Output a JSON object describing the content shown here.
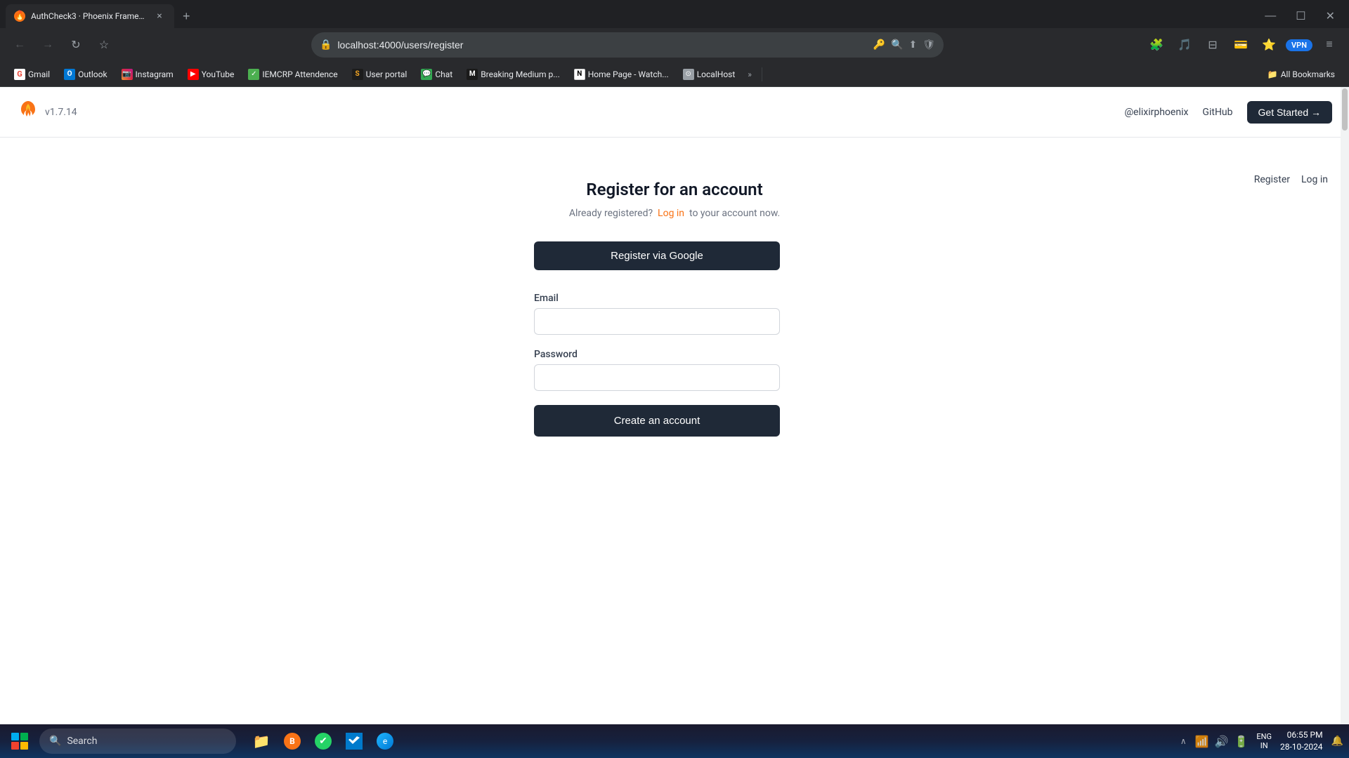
{
  "browser": {
    "tab": {
      "title": "AuthCheck3 · Phoenix Framew...",
      "favicon": "🔥",
      "close_label": "×"
    },
    "new_tab_label": "+",
    "window_controls": {
      "minimize": "—",
      "maximize": "☐",
      "close": "✕"
    },
    "nav": {
      "back": "←",
      "forward": "→",
      "reload": "↻",
      "bookmark": "☆",
      "address": "localhost:4000/users/register",
      "lock_icon": "🔒",
      "icons": [
        "🔑",
        "🔍",
        "⬆",
        "🛡"
      ],
      "vpn_label": "VPN",
      "menu": "≡"
    },
    "bookmarks": [
      {
        "label": "Gmail",
        "icon": "G",
        "color_class": "bk-gmail"
      },
      {
        "label": "Outlook",
        "icon": "O",
        "color_class": "bk-outlook"
      },
      {
        "label": "Instagram",
        "icon": "📷",
        "color_class": "bk-instagram"
      },
      {
        "label": "YouTube",
        "icon": "▶",
        "color_class": "bk-youtube"
      },
      {
        "label": "IEMCRP Attendence",
        "icon": "✓",
        "color_class": "bk-iemcrp"
      },
      {
        "label": "User portal",
        "icon": "S",
        "color_class": "bk-scrimba"
      },
      {
        "label": "Chat",
        "icon": "💬",
        "color_class": "bk-chat"
      },
      {
        "label": "Breaking Medium p...",
        "icon": "M",
        "color_class": "bk-medium"
      },
      {
        "label": "Home Page - Watch...",
        "icon": "N",
        "color_class": "bk-notion"
      },
      {
        "label": "LocalHost",
        "icon": "⊙",
        "color_class": "bk-localhost"
      }
    ],
    "more_bookmarks": "»",
    "all_bookmarks": "All Bookmarks"
  },
  "phoenix": {
    "logo_icon": "🦅",
    "version": "v1.7.14",
    "nav_links": {
      "elixir": "@elixirphoenix",
      "github": "GitHub"
    },
    "get_started": "Get Started →",
    "top_nav": {
      "register": "Register",
      "login": "Log in"
    }
  },
  "page": {
    "title": "Register for an account",
    "subtitle_pre": "Already registered?",
    "subtitle_link": "Log in",
    "subtitle_post": "to your account now.",
    "google_button": "Register via Google",
    "email_label": "Email",
    "email_placeholder": "",
    "password_label": "Password",
    "password_placeholder": "",
    "submit_button": "Create an account"
  },
  "taskbar": {
    "search_placeholder": "Search",
    "language": "ENG\nIN",
    "time": "06:55 PM",
    "date": "28-10-2024",
    "notification_icon": "🔔",
    "chevron": "∧"
  }
}
